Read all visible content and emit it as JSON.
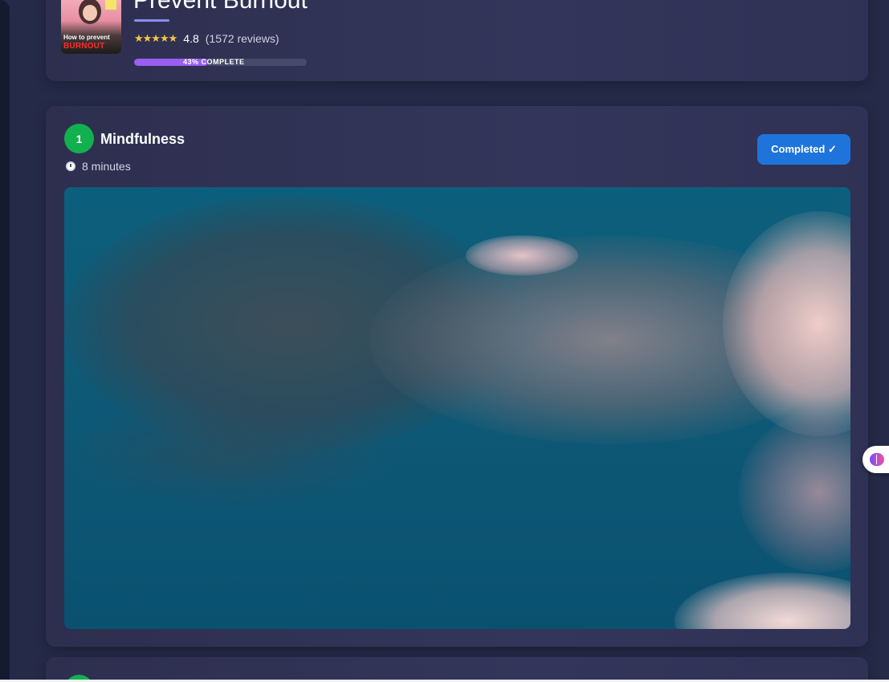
{
  "course": {
    "title": "Prevent Burnout",
    "thumbnail_line1": "How to prevent",
    "thumbnail_line2": "BURNOUT",
    "stars": "★★★★★",
    "rating": "4.8",
    "reviews": "(1572 reviews)",
    "progress_percent": 43,
    "progress_label": "43% COMPLETE"
  },
  "lesson": {
    "number": "1",
    "title": "Mindfulness",
    "duration": "8 minutes",
    "status_button": "Completed ✓"
  },
  "colors": {
    "accent_purple": "#9a5ef0",
    "complete_blue": "#1f74dc",
    "lesson_green": "#12b04e",
    "star_gold": "#f6c544"
  },
  "icons": {
    "duration": "stopwatch-icon",
    "side_widget": "brain-icon"
  }
}
